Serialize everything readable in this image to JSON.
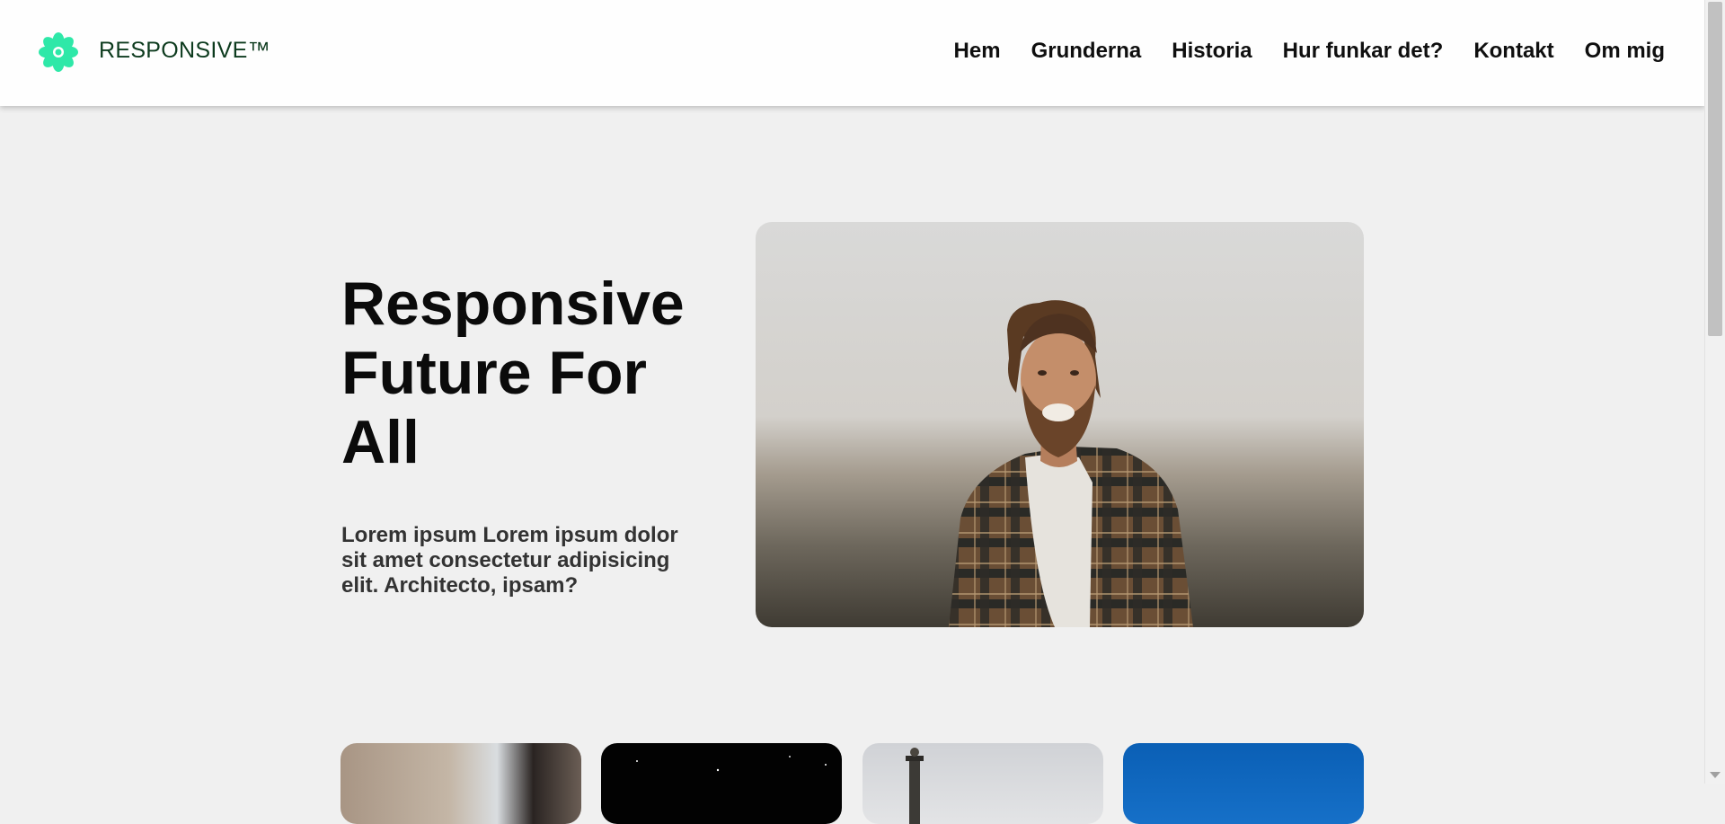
{
  "header": {
    "logo_icon": "flower-icon",
    "logo_text": "RESPONSIVE™",
    "nav": [
      "Hem",
      "Grunderna",
      "Historia",
      "Hur funkar det?",
      "Kontakt",
      "Om mig"
    ]
  },
  "hero": {
    "title": "Responsive Future For All",
    "text": "Lorem ipsum Lorem ipsum dolor sit amet consectetur adipisicing elit. Architecto, ipsam?",
    "image": "smiling-man-photo"
  },
  "cards": [
    "woman-photo",
    "night-sky-photo",
    "lighthouse-photo",
    "blue-sky-photo"
  ],
  "colors": {
    "accent": "#2ee8a8",
    "logo_text": "#0d3b1e",
    "background": "#f0f0f0",
    "header_bg": "#fefefe"
  }
}
